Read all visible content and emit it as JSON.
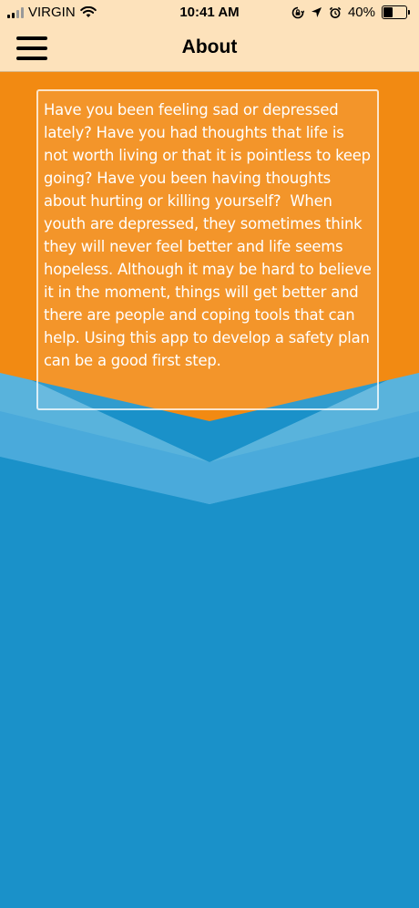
{
  "status_bar": {
    "carrier": "VIRGIN",
    "time": "10:41 AM",
    "battery_percent": "40%",
    "battery_level": 0.4,
    "icons": [
      "signal-icon",
      "wifi-icon",
      "rotation-lock-icon",
      "location-icon",
      "alarm-icon",
      "battery-icon"
    ]
  },
  "nav": {
    "title": "About",
    "menu_icon": "hamburger-menu-icon"
  },
  "content": {
    "about_text": "Have you been feeling sad or depressed lately? Have you had thoughts that life is not worth living or that it is pointless to keep going? Have you been having thoughts about hurting or killing yourself?  When youth are depressed, they sometimes think they will never feel better and life seems hopeless. Although it may be hard to believe it in the moment, things will get better and there are people and coping tools that can help. Using this app to develop a safety plan can be a good first step."
  },
  "colors": {
    "header_bg": "#fde2bb",
    "orange": "#f28a12",
    "light_blue": "#59b3dc",
    "mid_blue": "#3ea4d6",
    "dark_blue": "#1a91c9"
  }
}
